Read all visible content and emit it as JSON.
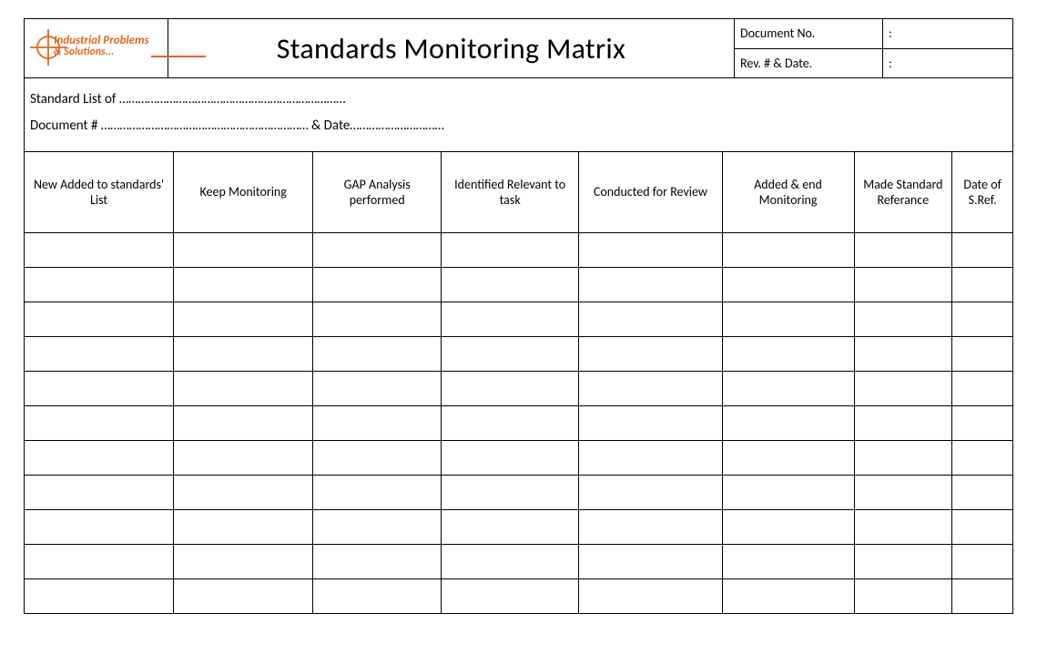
{
  "logo": {
    "line1": "Industrial Problems",
    "line2": "& Solutions..."
  },
  "title": "Standards Monitoring Matrix",
  "meta": {
    "docNoLabel": "Document No.",
    "docNoValue": ":",
    "revLabel": "Rev. # & Date.",
    "revValue": ":"
  },
  "info": {
    "standardListOf": "Standard List of ………………………………………………………………",
    "documentNumber": "Document # …………………………………………………………  & Date…………………………"
  },
  "columns": [
    "New Added to standards' List",
    "Keep Monitoring",
    "GAP Analysis performed",
    "Identified Relevant to task",
    "Conducted for Review",
    "Added & end Monitoring",
    "Made Standard Referance",
    "Date of S.Ref."
  ],
  "rowCount": 11
}
